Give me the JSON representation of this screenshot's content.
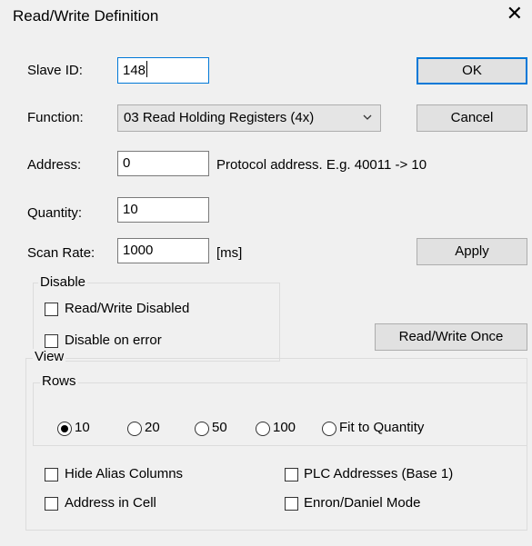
{
  "dialog": {
    "title": "Read/Write Definition",
    "close_symbol": "✕"
  },
  "form": {
    "slave_id": {
      "label": "Slave ID:",
      "value": "148"
    },
    "function": {
      "label": "Function:",
      "value": "03 Read Holding Registers (4x)"
    },
    "address": {
      "label": "Address:",
      "value": "0",
      "hint": "Protocol address. E.g. 40011 -> 10"
    },
    "quantity": {
      "label": "Quantity:",
      "value": "10"
    },
    "scan_rate": {
      "label": "Scan Rate:",
      "value": "1000",
      "unit": "[ms]"
    }
  },
  "buttons": {
    "ok": "OK",
    "cancel": "Cancel",
    "apply": "Apply",
    "read_write_once": "Read/Write Once"
  },
  "disable": {
    "legend": "Disable",
    "read_write_disabled": {
      "label": "Read/Write Disabled",
      "checked": false
    },
    "disable_on_error": {
      "label": "Disable on error",
      "checked": false
    }
  },
  "view": {
    "legend": "View",
    "rows": {
      "legend": "Rows",
      "options": [
        "10",
        "20",
        "50",
        "100",
        "Fit to Quantity"
      ],
      "selected": "10"
    },
    "hide_alias_columns": {
      "label": "Hide Alias Columns",
      "checked": false
    },
    "address_in_cell": {
      "label": "Address in Cell",
      "checked": false
    },
    "plc_addresses": {
      "label": "PLC Addresses (Base 1)",
      "checked": false
    },
    "enron_daniel_mode": {
      "label": "Enron/Daniel Mode",
      "checked": false
    }
  },
  "icons": {
    "close": "close-icon",
    "dropdown": "chevron-down-icon"
  },
  "colors": {
    "focus_accent": "#0078d7",
    "dialog_bg": "#f0f0f0"
  }
}
